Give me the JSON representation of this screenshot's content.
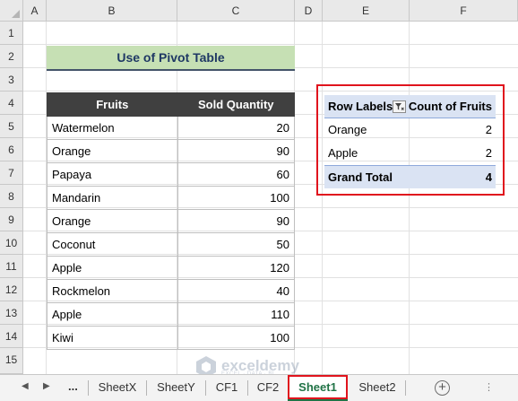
{
  "columns": [
    "A",
    "B",
    "C",
    "D",
    "E",
    "F"
  ],
  "rows": [
    "1",
    "2",
    "3",
    "4",
    "5",
    "6",
    "7",
    "8",
    "9",
    "10",
    "11",
    "12",
    "13",
    "14",
    "15"
  ],
  "title": "Use of Pivot Table",
  "table": {
    "headers": [
      "Fruits",
      "Sold Quantity"
    ],
    "rows": [
      [
        "Watermelon",
        "20"
      ],
      [
        "Orange",
        "90"
      ],
      [
        "Papaya",
        "60"
      ],
      [
        "Mandarin",
        "100"
      ],
      [
        "Orange",
        "90"
      ],
      [
        "Coconut",
        "50"
      ],
      [
        "Apple",
        "120"
      ],
      [
        "Rockmelon",
        "40"
      ],
      [
        "Apple",
        "110"
      ],
      [
        "Kiwi",
        "100"
      ]
    ]
  },
  "pivot": {
    "row_labels": "Row Labels",
    "value_header": "Count of Fruits",
    "filter_icon": "filter-icon",
    "rows": [
      [
        "Orange",
        "2"
      ],
      [
        "Apple",
        "2"
      ]
    ],
    "total_label": "Grand Total",
    "total_value": "4"
  },
  "tabs": {
    "more": "...",
    "items": [
      "SheetX",
      "SheetY",
      "CF1",
      "CF2",
      "Sheet1",
      "Sheet2"
    ],
    "active": "Sheet1",
    "add_icon": "plus-circle-icon"
  },
  "watermark": {
    "name": "exceldemy",
    "tagline": "EXCEL · DATA · BI"
  },
  "colors": {
    "title_fill": "#c6e0b4",
    "table_header": "#404040",
    "pivot_fill": "#dae3f3",
    "highlight": "#e0141d",
    "active_tab": "#217346"
  }
}
